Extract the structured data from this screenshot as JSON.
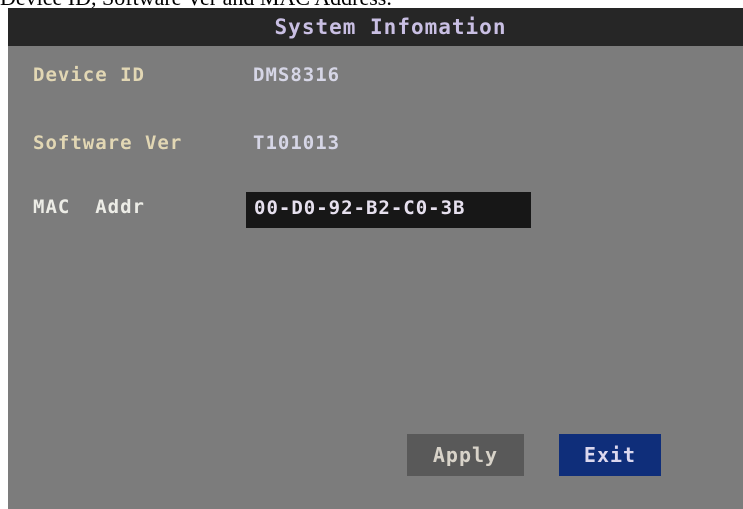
{
  "caption": "Device ID, Software Ver and MAC Address.",
  "window": {
    "title": "System Infomation"
  },
  "fields": [
    {
      "label": "Device ID",
      "value": "DMS8316"
    },
    {
      "label": "Software Ver",
      "value": "T101013"
    },
    {
      "label": "MAC  Addr",
      "value": "00-D0-92-B2-C0-3B"
    }
  ],
  "buttons": {
    "apply": "Apply",
    "exit": "Exit"
  },
  "colors": {
    "background": "#7c7c7c",
    "titlebar": "#262626",
    "apply_button": "#595959",
    "exit_button": "#0f2e7a"
  }
}
